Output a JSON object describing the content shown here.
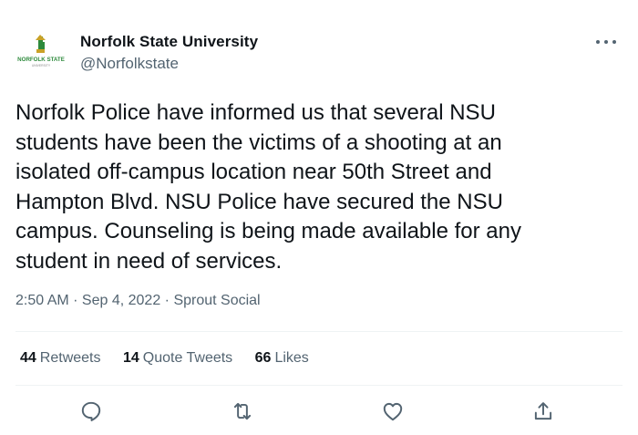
{
  "author": {
    "name": "Norfolk State University",
    "handle": "@Norfolkstate",
    "logo_text": "NORFOLK STATE",
    "logo_subtext": "UNIVERSITY"
  },
  "tweet": {
    "lines": [
      "Norfolk Police have informed us that several NSU",
      "students have been the victims of a shooting at an",
      "isolated off-campus location near 50th Street and",
      "Hampton Blvd. NSU Police have secured the NSU",
      "campus. Counseling is being made available for any",
      "student in need of services."
    ]
  },
  "meta": {
    "time": "2:50 AM",
    "separator": " · ",
    "date": "Sep 4, 2022",
    "source": "Sprout Social"
  },
  "stats": {
    "retweets_count": "44",
    "retweets_label": "Retweets",
    "quote_count": "14",
    "quote_label": "Quote Tweets",
    "likes_count": "66",
    "likes_label": "Likes"
  },
  "actions": [
    "reply-icon",
    "retweet-icon",
    "like-icon",
    "share-icon"
  ],
  "colors": {
    "text_primary": "#0f1419",
    "text_secondary": "#536471",
    "logo_green": "#2e8a3c",
    "logo_gold": "#c9a227"
  }
}
